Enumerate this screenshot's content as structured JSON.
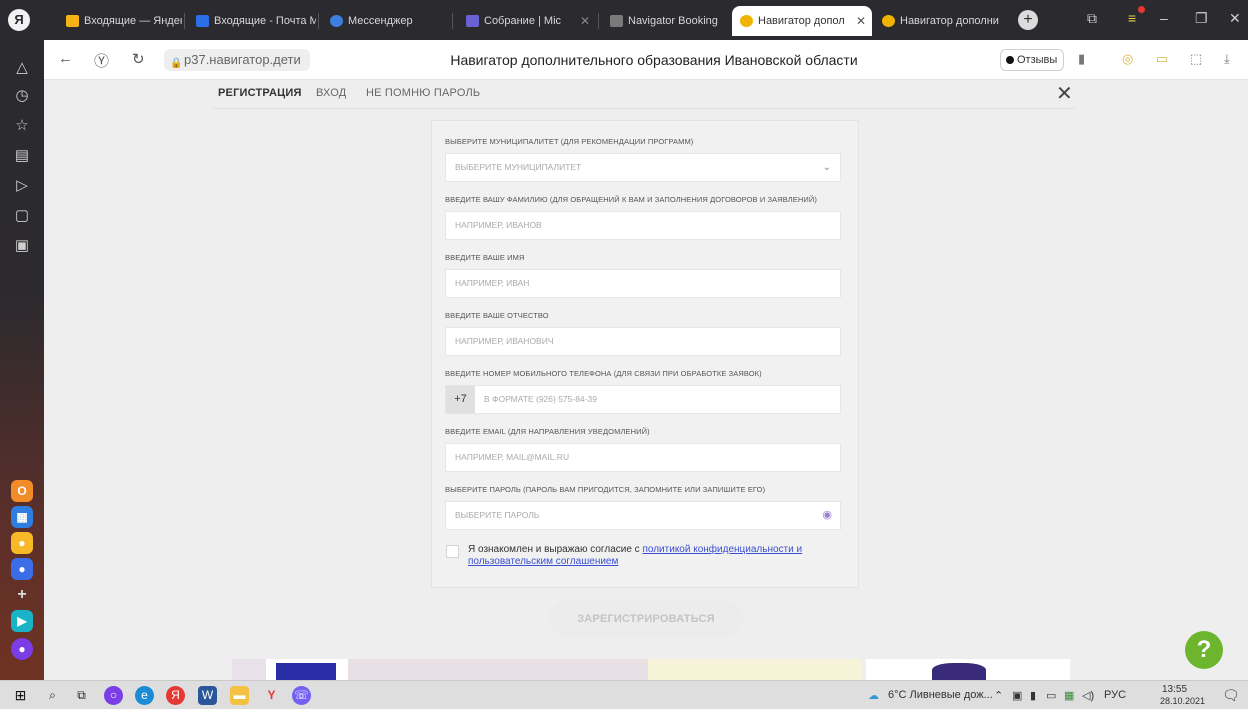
{
  "browser": {
    "tabs": [
      {
        "title": "Входящие — Яндекс",
        "color": "#f5b318"
      },
      {
        "title": "Входящие - Почта Mail",
        "color": "#2b6ee6"
      },
      {
        "title": "Мессенджер",
        "color": "#3d7fe0"
      },
      {
        "title": "Собрание | Mic",
        "color": "#6a62d4"
      },
      {
        "title": "Navigator Booking",
        "color": "#7a7a7a"
      },
      {
        "title": "Навигатор допол",
        "color": "#f0b400"
      },
      {
        "title": "Навигатор дополни",
        "color": "#f0b400"
      }
    ],
    "url": "р37.навигатор.дети",
    "page_title": "Навигатор дополнительного образования Ивановской области",
    "reviews_label": "Отзывы"
  },
  "form": {
    "nav": {
      "register": "РЕГИСТРАЦИЯ",
      "login": "ВХОД",
      "forgot": "НЕ ПОМНЮ ПАРОЛЬ"
    },
    "close_glyph": "✕",
    "municipality": {
      "label": "ВЫБЕРИТЕ МУНИЦИПАЛИТЕТ (ДЛЯ РЕКОМЕНДАЦИИ ПРОГРАММ)",
      "placeholder": "ВЫБЕРИТЕ МУНИЦИПАЛИТЕТ"
    },
    "surname": {
      "label": "ВВЕДИТЕ ВАШУ ФАМИЛИЮ (ДЛЯ ОБРАЩЕНИЙ К ВАМ И ЗАПОЛНЕНИЯ ДОГОВОРОВ И ЗАЯВЛЕНИЙ)",
      "placeholder": "НАПРИМЕР, ИВАНОВ"
    },
    "name": {
      "label": "ВВЕДИТЕ ВАШЕ ИМЯ",
      "placeholder": "НАПРИМЕР, ИВАН"
    },
    "patronymic": {
      "label": "ВВЕДИТЕ ВАШЕ ОТЧЕСТВО",
      "placeholder": "НАПРИМЕР, ИВАНОВИЧ"
    },
    "phone": {
      "label": "ВВЕДИТЕ НОМЕР МОБИЛЬНОГО ТЕЛЕФОНА (ДЛЯ СВЯЗИ ПРИ ОБРАБОТКЕ ЗАЯВОК)",
      "prefix": "+7",
      "placeholder": "В ФОРМАТЕ (926) 575-84-39"
    },
    "email": {
      "label": "ВВЕДИТЕ EMAIL (ДЛЯ НАПРАВЛЕНИЯ УВЕДОМЛЕНИЙ)",
      "placeholder": "НАПРИМЕР, MAIL@MAIL.RU"
    },
    "password": {
      "label": "ВЫБЕРИТЕ ПАРОЛЬ (ПАРОЛЬ ВАМ ПРИГОДИТСЯ, ЗАПОМНИТЕ ИЛИ ЗАПИШИТЕ ЕГО)",
      "placeholder": "ВЫБЕРИТЕ ПАРОЛЬ"
    },
    "agreement": {
      "text": "Я ознакомлен и выражаю согласие с ",
      "link": "политикой конфиденциальности и пользовательским соглашением"
    },
    "submit": "ЗАРЕГИСТРИРОВАТЬСЯ",
    "help": "?"
  },
  "taskbar": {
    "weather": "6°C Ливневые дож...",
    "lang": "РУС",
    "time": "13:55",
    "date": "28.10.2021"
  },
  "colors": {
    "accent_link": "#3b4fd1",
    "help_button": "#6cb52d"
  }
}
